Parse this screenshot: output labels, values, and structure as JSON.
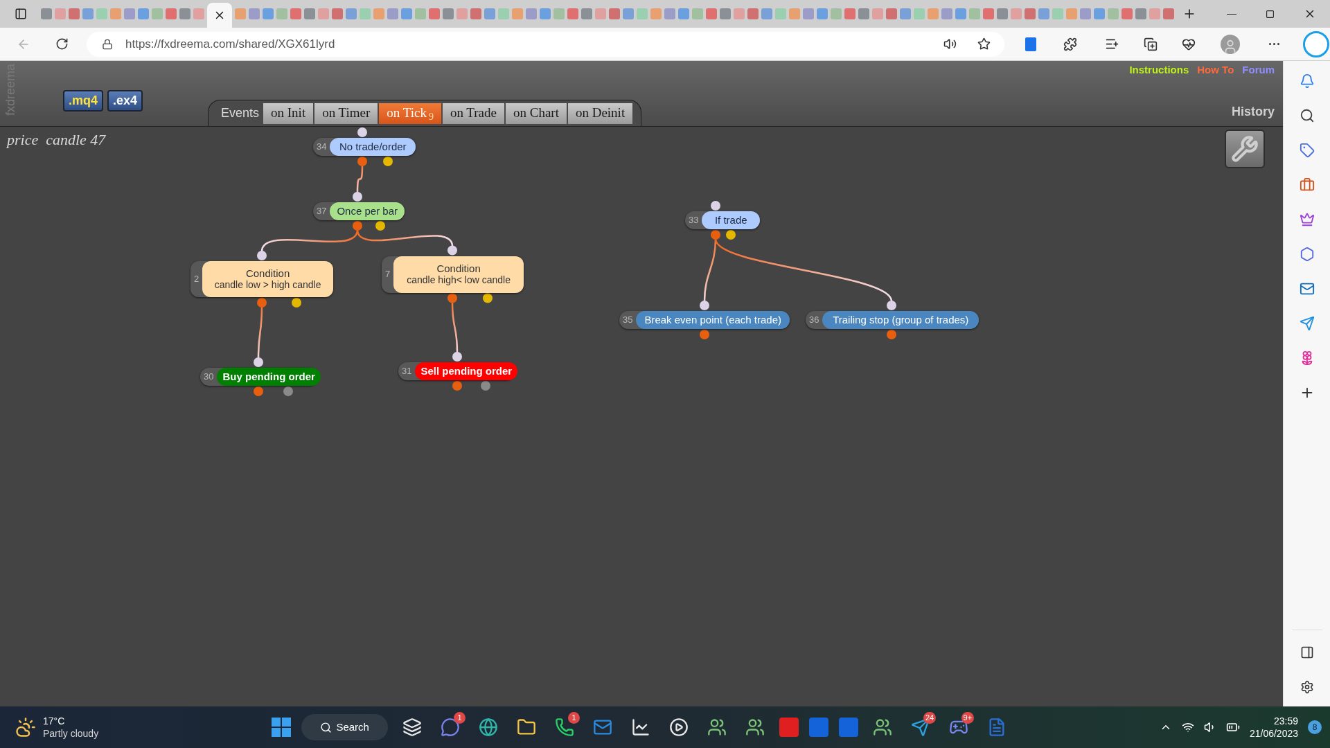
{
  "browser": {
    "url": "https://fxdreema.com/shared/XGX61lyrd"
  },
  "header_links": [
    {
      "label": "Instructions",
      "color": "#bff21a"
    },
    {
      "label": "How To",
      "color": "#ff6a3d"
    },
    {
      "label": "Forum",
      "color": "#8f8fff"
    }
  ],
  "brand": "fxdreema",
  "file_buttons": [
    ".mq4",
    ".ex4"
  ],
  "events_label": "Events",
  "tabs": [
    {
      "label": "on Init",
      "selected": false
    },
    {
      "label": "on Timer",
      "selected": false
    },
    {
      "label": "on Tick",
      "badge": "9",
      "selected": true
    },
    {
      "label": "on Trade",
      "selected": false
    },
    {
      "label": "on Chart",
      "selected": false
    },
    {
      "label": "on Deinit",
      "selected": false
    }
  ],
  "history": "History",
  "project_title": "price  candle 47",
  "blocks": [
    {
      "number": "34",
      "kind": "filter",
      "label": "No trade/order",
      "color": "#aecbff",
      "children": [
        {
          "number": "37",
          "kind": "filter",
          "label": "Once per bar",
          "color": "#a9e08c",
          "children": [
            {
              "number": "2",
              "kind": "condition",
              "title": "Condition",
              "label": "candle low > high candle",
              "color": "#ffdba8",
              "children": [
                {
                  "number": "30",
                  "kind": "action",
                  "label": "Buy pending order",
                  "color": "#008000"
                }
              ]
            },
            {
              "number": "7",
              "kind": "condition",
              "title": "Condition",
              "label": "candle high< low candle",
              "color": "#ffdba8",
              "children": [
                {
                  "number": "31",
                  "kind": "action",
                  "label": "Sell pending order",
                  "color": "#ff0000"
                }
              ]
            }
          ]
        }
      ]
    },
    {
      "number": "33",
      "kind": "filter",
      "label": "If trade",
      "color": "#aecbff",
      "children": [
        {
          "number": "35",
          "kind": "modify",
          "label": "Break even point (each trade)",
          "color": "#4a86bf"
        },
        {
          "number": "36",
          "kind": "modify",
          "label": "Trailing stop (group of trades)",
          "color": "#4a86bf"
        }
      ]
    }
  ],
  "taskbar": {
    "weather": {
      "temperature": "17°C",
      "condition": "Partly cloudy"
    },
    "apps": [
      {
        "kind": "start"
      },
      {
        "kind": "search",
        "label": "Search"
      },
      {
        "kind": "taskview"
      },
      {
        "kind": "chat",
        "badge": "1"
      },
      {
        "kind": "browser"
      },
      {
        "kind": "folder"
      },
      {
        "kind": "phone",
        "badge": "1"
      },
      {
        "kind": "mail"
      },
      {
        "kind": "chart"
      },
      {
        "kind": "player"
      },
      {
        "kind": "people"
      },
      {
        "kind": "people"
      },
      {
        "kind": "square-red"
      },
      {
        "kind": "square-blue"
      },
      {
        "kind": "square-blue"
      },
      {
        "kind": "people"
      },
      {
        "kind": "send",
        "badge": "24"
      },
      {
        "kind": "gamepad",
        "badge": "9+"
      },
      {
        "kind": "doc"
      }
    ],
    "time": "23:59",
    "date": "21/06/2023",
    "notifications": "8"
  }
}
